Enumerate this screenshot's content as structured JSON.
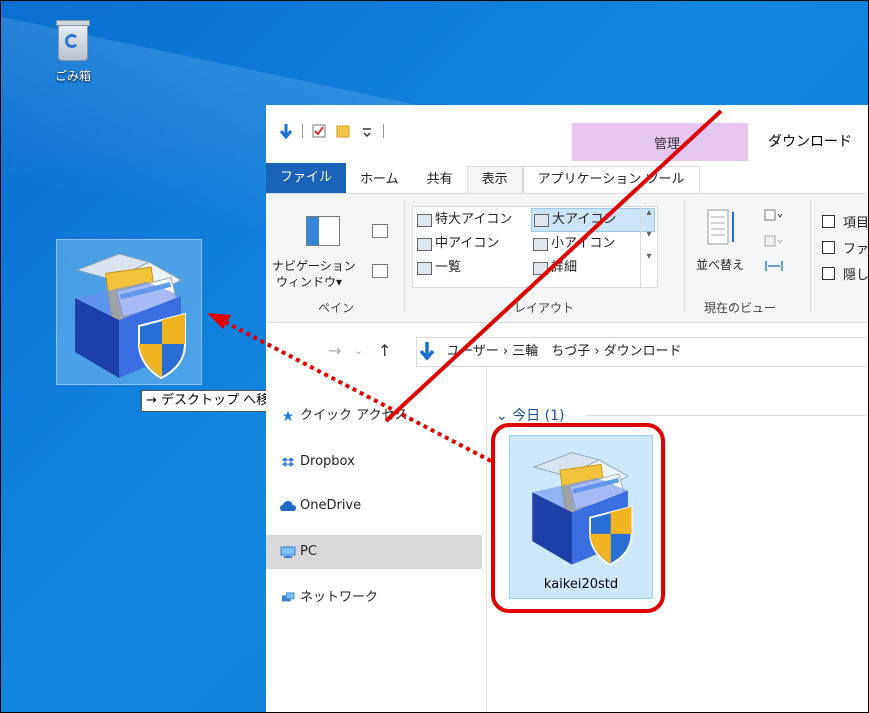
{
  "desktop": {
    "recycle_bin_label": "ごみ箱",
    "drag_tooltip": "→ デスクトップ へ移動"
  },
  "explorer": {
    "context_tab_label": "管理",
    "window_title": "ダウンロード",
    "tabs": [
      "ファイル",
      "ホーム",
      "共有",
      "表示",
      "アプリケーション ツール"
    ],
    "ribbon": {
      "pane_group": {
        "nav_pane_label_1": "ナビゲーション",
        "nav_pane_label_2": "ウィンドウ▾",
        "group_label": "ペイン"
      },
      "layout_group": {
        "items": [
          "特大アイコン",
          "大アイコン",
          "中アイコン",
          "小アイコン",
          "一覧",
          "詳細"
        ],
        "selected": "大アイコン",
        "group_label": "レイアウト"
      },
      "view_group": {
        "sort_label": "並べ替え",
        "group_label": "現在のビュー"
      },
      "show_hide": [
        "項目",
        "ファ",
        "隠し"
      ]
    },
    "address": {
      "path": "ユーザー › 三輪　ちづ子 › ダウンロード"
    },
    "nav_pane": {
      "items": [
        "クイック アクセス",
        "Dropbox",
        "OneDrive",
        "PC",
        "ネットワーク"
      ],
      "selected": "PC"
    },
    "content": {
      "group_header": "今日 (1)",
      "file_name": "kaikei20std"
    }
  },
  "colors": {
    "desktop_blue": "#0f7ad8",
    "file_tab": "#1964b8",
    "context_tab": "#e6c7f0",
    "highlight": "#e00000"
  }
}
